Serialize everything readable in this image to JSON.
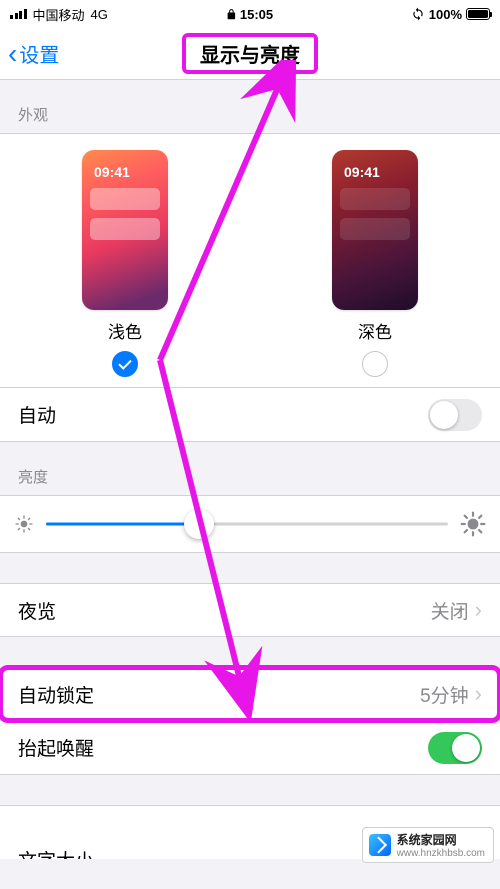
{
  "status": {
    "carrier": "中国移动",
    "network": "4G",
    "time": "15:05",
    "battery_pct": "100%"
  },
  "nav": {
    "back": "设置",
    "title": "显示与亮度"
  },
  "appearance": {
    "header": "外观",
    "preview_time": "09:41",
    "light_label": "浅色",
    "dark_label": "深色",
    "selected": "light"
  },
  "auto_appearance": {
    "label": "自动",
    "on": false
  },
  "brightness": {
    "header": "亮度",
    "value_pct": 38
  },
  "night_shift": {
    "label": "夜览",
    "value": "关闭"
  },
  "auto_lock": {
    "label": "自动锁定",
    "value": "5分钟"
  },
  "raise_to_wake": {
    "label": "抬起唤醒",
    "on": true
  },
  "cutoff_row": {
    "label_partial": "文字大小"
  },
  "watermark": {
    "name": "系统家园网",
    "url": "www.hnzkhbsb.com"
  }
}
